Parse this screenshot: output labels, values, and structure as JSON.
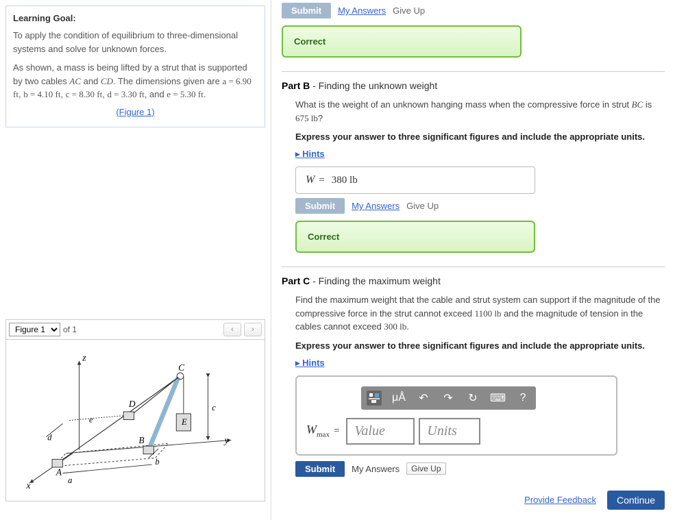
{
  "goal": {
    "title": "Learning Goal:",
    "p1": "To apply the condition of equilibrium to three-dimensional systems and solve for unknown forces.",
    "p2_a": "As shown, a mass is being lifted by a strut that is supported by two cables ",
    "p2_ac": "AC",
    "p2_and": " and ",
    "p2_cd": "CD",
    "p2_b": ". The dimensions given are ",
    "dim_a": "a = 6.90 ft",
    "dim_sep": ", ",
    "dim_b": "b = 4.10 ft",
    "dim_c": "c = 8.30 ft",
    "dim_d": "d = 3.30 ft",
    "dim_and": ", and ",
    "dim_e": "e = 5.30 ft",
    "dim_end": ".",
    "figlink": "(Figure 1)"
  },
  "figure": {
    "selected": "Figure 1",
    "of": "of 1",
    "prev": "‹",
    "next": "›",
    "labels": {
      "z": "z",
      "y": "y",
      "x": "x",
      "a": "a",
      "b": "b",
      "c": "c",
      "d": "d",
      "e": "e",
      "A": "A",
      "B": "B",
      "C": "C",
      "D": "D",
      "E": "E"
    }
  },
  "shared": {
    "submit": "Submit",
    "my_answers": "My Answers",
    "give_up": "Give Up",
    "correct": "Correct",
    "hints": "Hints",
    "instruct": "Express your answer to three significant figures and include the appropriate units."
  },
  "partA": {},
  "partB": {
    "heading_bold": "Part B",
    "heading_rest": " - Finding the unknown weight",
    "q1": "What is the weight of an unknown hanging mass when the compressive force in strut ",
    "q_var": "BC",
    "q2": " is ",
    "q_val": "675 lb",
    "q3": "?",
    "ans_var": "W",
    "ans_eq": "=",
    "ans_val": "380 lb"
  },
  "partC": {
    "heading_bold": "Part C",
    "heading_rest": " - Finding the maximum weight",
    "q1": "Find the maximum weight that the cable and strut system can support if the magnitude of the compressive force in the strut cannot exceed ",
    "q_v1": "1100 lb",
    "q2": " and the magnitude of tension in the cables cannot exceed ",
    "q_v2": "300 lb",
    "q3": ".",
    "input_var": "W",
    "input_sub": "max",
    "eq": "=",
    "value_ph": "Value",
    "units_ph": "Units",
    "toolbar": {
      "frac": "frac",
      "mu": "μÅ",
      "undo": "↶",
      "redo": "↷",
      "reset": "↻",
      "keyboard": "⌨",
      "help": "?"
    }
  },
  "footer": {
    "feedback": "Provide Feedback",
    "continue": "Continue"
  }
}
